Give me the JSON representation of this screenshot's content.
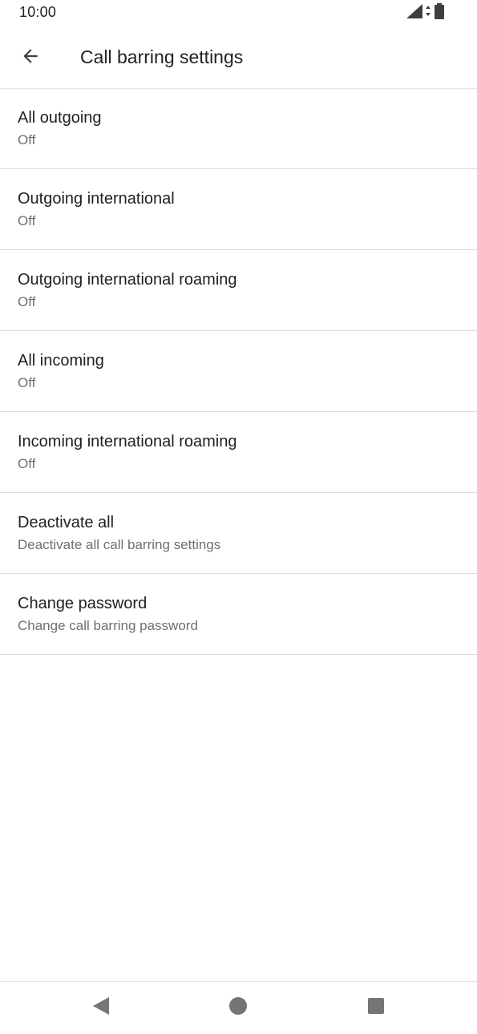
{
  "status_bar": {
    "time": "10:00",
    "icons": [
      "signal-icon",
      "data-arrows-icon",
      "battery-icon"
    ]
  },
  "app_bar": {
    "back_icon": "arrow-left-icon",
    "title": "Call barring settings"
  },
  "settings": {
    "items": [
      {
        "title": "All outgoing",
        "summary": "Off"
      },
      {
        "title": "Outgoing international",
        "summary": "Off"
      },
      {
        "title": "Outgoing international roaming",
        "summary": "Off"
      },
      {
        "title": "All incoming",
        "summary": "Off"
      },
      {
        "title": "Incoming international roaming",
        "summary": "Off"
      },
      {
        "title": "Deactivate all",
        "summary": "Deactivate all call barring settings"
      },
      {
        "title": "Change password",
        "summary": "Change call barring password"
      }
    ]
  },
  "nav_bar": {
    "icons": [
      "back-triangle-icon",
      "home-circle-icon",
      "recents-square-icon"
    ]
  },
  "colors": {
    "text_primary": "#202124",
    "text_secondary": "#6f6f6f",
    "divider": "#dcdcdc",
    "icon": "#5f6368"
  }
}
